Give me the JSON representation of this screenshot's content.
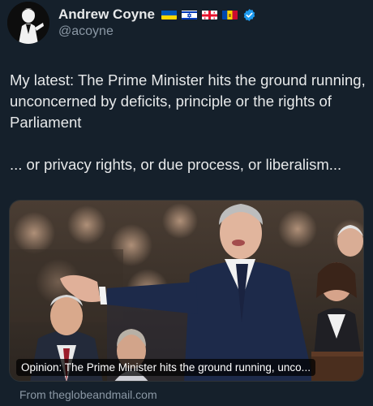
{
  "author": {
    "display_name": "Andrew Coyne",
    "handle": "@acoyne",
    "avatar_icon": "caricature-avatar-icon",
    "flag_icons": [
      "ukraine-flag-icon",
      "israel-flag-icon",
      "georgia-flag-icon",
      "moldova-flag-icon"
    ],
    "verified_icon": "verified-badge-icon"
  },
  "tweet": {
    "paragraph_1": "My latest: The Prime Minister hits the ground running, unconcerned by deficits, principle or the rights of Parliament",
    "paragraph_2": "... or privacy rights, or due process, or liberalism..."
  },
  "link_card": {
    "image_icon": "article-photo",
    "caption": "Opinion: The Prime Minister hits the ground running, unco...",
    "source": "From theglobeandmail.com"
  },
  "colors": {
    "background": "#15202b",
    "text": "#e7e9ea",
    "muted": "#8b98a5",
    "verified": "#1d9bf0"
  }
}
